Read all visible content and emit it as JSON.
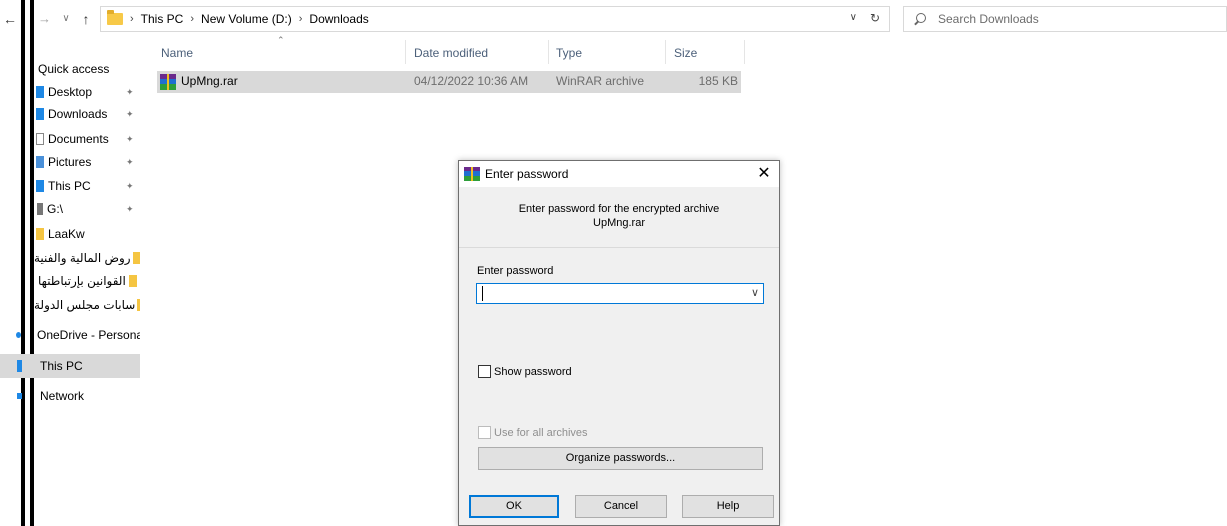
{
  "explorer": {
    "breadcrumb": [
      "This PC",
      "New Volume (D:)",
      "Downloads"
    ],
    "search_placeholder": "Search Downloads",
    "columns": {
      "name": "Name",
      "date": "Date modified",
      "type": "Type",
      "size": "Size"
    },
    "files": [
      {
        "name": "UpMng.rar",
        "date": "04/12/2022 10:36 AM",
        "type": "WinRAR archive",
        "size": "185 KB"
      }
    ]
  },
  "sidebar": {
    "quick_access": "Quick access",
    "items": [
      {
        "label": "Desktop",
        "icon": "desktop-icon",
        "pinned": true
      },
      {
        "label": "Downloads",
        "icon": "download-icon",
        "pinned": true
      },
      {
        "label": "Documents",
        "icon": "document-icon",
        "pinned": true
      },
      {
        "label": "Pictures",
        "icon": "pictures-icon",
        "pinned": true
      },
      {
        "label": "This PC",
        "icon": "computer-icon",
        "pinned": true
      },
      {
        "label": "G:\\",
        "icon": "usb-drive-icon",
        "pinned": true
      },
      {
        "label": "LaaKw",
        "icon": "folder-icon"
      },
      {
        "label": "روض المالية والفنية",
        "icon": "folder-icon"
      },
      {
        "label": "القوانين بإرتباطتها",
        "icon": "folder-icon"
      },
      {
        "label": "سابات مجلس الدولة",
        "icon": "folder-icon"
      }
    ],
    "onedrive": "OneDrive - Persona",
    "this_pc": "This PC",
    "network": "Network"
  },
  "dialog": {
    "title": "Enter password",
    "message_line1": "Enter password for the encrypted archive",
    "message_line2": "UpMng.rar",
    "password_label": "Enter password",
    "password_value": "",
    "show_password_label": "Show password",
    "use_for_all_label": "Use for all archives",
    "organize_label": "Organize passwords...",
    "ok_label": "OK",
    "cancel_label": "Cancel",
    "help_label": "Help"
  },
  "colors": {
    "accent": "#0078d7",
    "selection": "#d9d9d9",
    "column_header": "#4c607a"
  }
}
